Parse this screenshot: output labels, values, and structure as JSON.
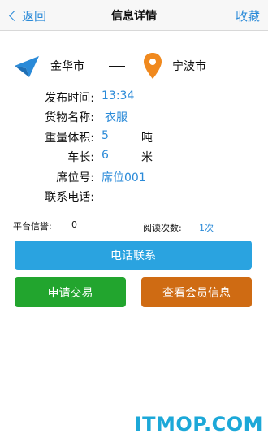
{
  "nav": {
    "back_label": "返回",
    "title": "信息详情",
    "favorite_label": "收藏"
  },
  "route": {
    "from": "金华市",
    "to": "宁波市",
    "from_icon": "navigation-arrow-icon",
    "to_icon": "location-pin-icon"
  },
  "details": [
    {
      "label": "发布时间:",
      "value": "13:34",
      "unit": ""
    },
    {
      "label": "货物名称:",
      "value": "衣服",
      "unit": ""
    },
    {
      "label": "重量体积:",
      "value": "5",
      "unit": "吨"
    },
    {
      "label": "车长:",
      "value": "6",
      "unit": "米"
    },
    {
      "label": "席位号:",
      "value": "席位001",
      "unit": ""
    },
    {
      "label": "联系电话:",
      "value": "",
      "unit": ""
    }
  ],
  "stats": {
    "trust_label": "平台信誉:",
    "trust_value": "0",
    "reads_label": "阅读次数:",
    "reads_value": "1次"
  },
  "buttons": {
    "call": "电话联系",
    "trade": "申请交易",
    "member": "查看会员信息"
  },
  "watermark": "ITMOP.COM",
  "colors": {
    "accent": "#2a8ad8",
    "call_button": "#2aa3e0",
    "trade_button": "#22a52e",
    "member_button": "#cf6b13",
    "pin": "#f0891e",
    "watermark": "#1ca8d8"
  }
}
